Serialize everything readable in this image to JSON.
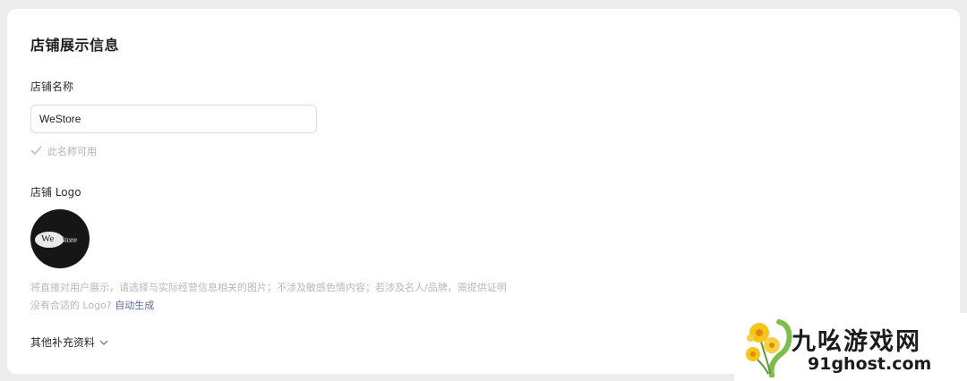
{
  "section": {
    "title": "店铺展示信息"
  },
  "store_name": {
    "label": "店铺名称",
    "value": "WeStore",
    "status": "此名称可用"
  },
  "logo": {
    "label": "店铺 Logo",
    "image_text_1": "We",
    "image_text_2": "Store",
    "hint": "将直接对用户展示，请选择与实际经营信息相关的图片；不涉及敏感色情内容；若涉及名人/品牌，需提供证明",
    "no_logo_prompt": "没有合适的 Logo?",
    "auto_generate_link": "自动生成"
  },
  "more": {
    "label": "其他补充资料"
  },
  "watermark": {
    "title": "九吆游戏网",
    "url": "91ghost.com"
  }
}
